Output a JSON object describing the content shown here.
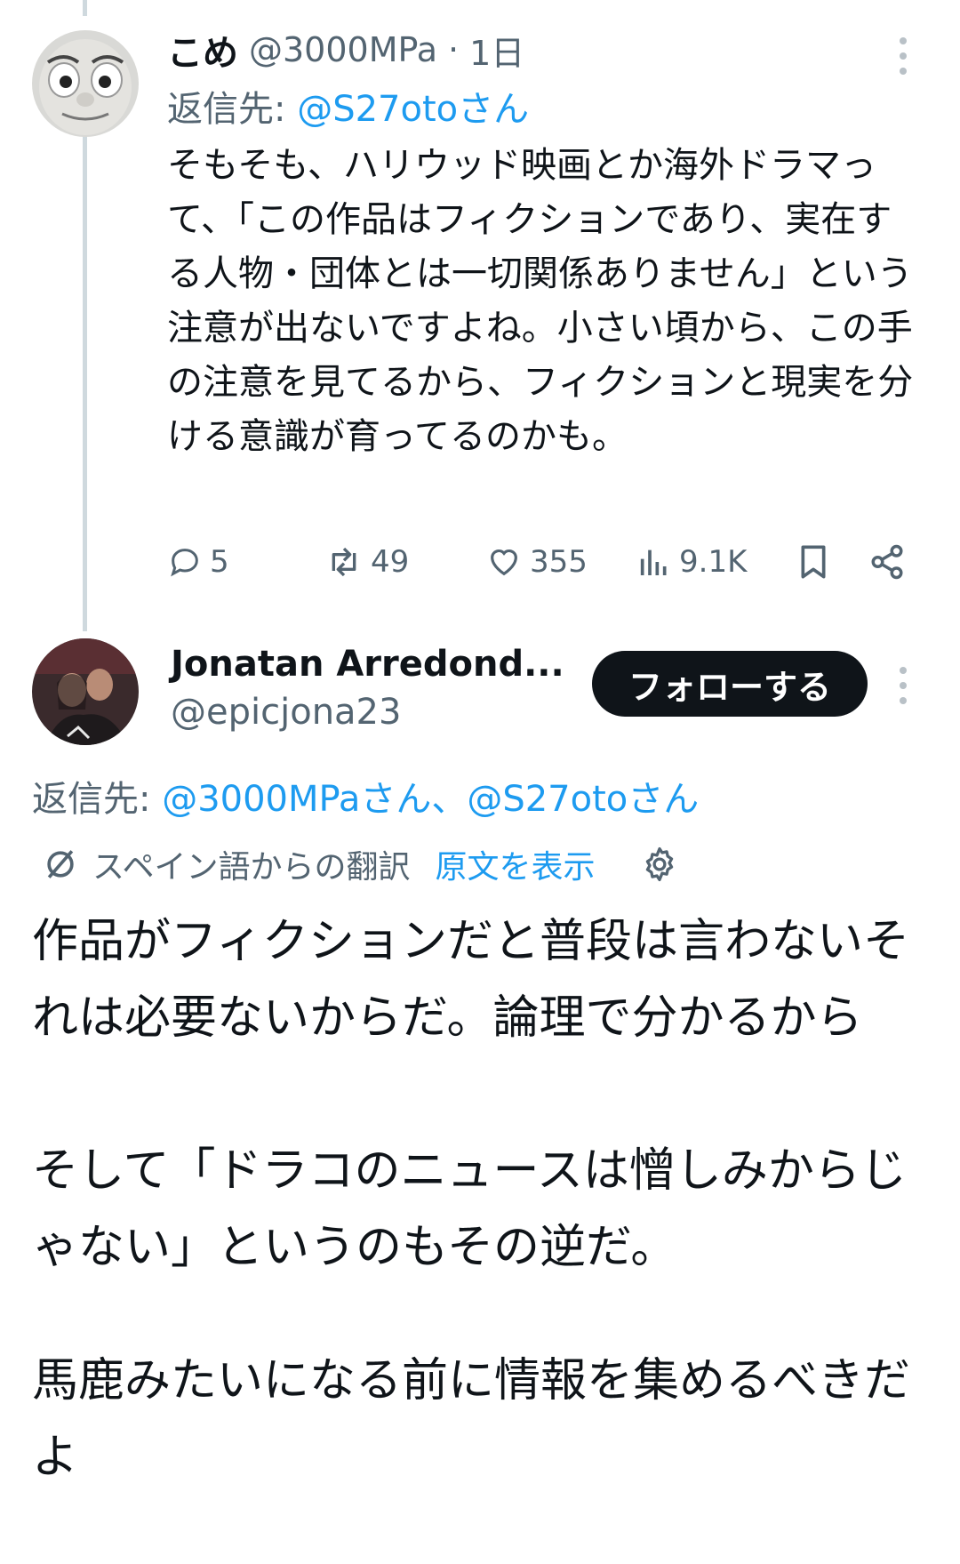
{
  "reply1": {
    "display_name": "こめ",
    "handle": "@3000MPa",
    "separator": "·",
    "time": "1日",
    "reply_to_prefix": "返信先:",
    "reply_to_users": "@S27otoさん",
    "text": "そもそも、ハリウッド映画とか海外ドラマって、「この作品はフィクションであり、実在する人物・団体とは一切関係ありません」という注意が出ないですよね。小さい頃から、この手の注意を見てるから、フィクションと現実を分ける意識が育ってるのかも。",
    "actions": {
      "replies": "5",
      "reposts": "49",
      "likes": "355",
      "views": "9.1K"
    },
    "icons": [
      "reply-icon",
      "repost-icon",
      "like-icon",
      "views-icon",
      "bookmark-icon",
      "share-icon",
      "more-icon"
    ]
  },
  "reply2": {
    "display_name": "Jonatan Arredond...",
    "handle": "@epicjona23",
    "follow_label": "フォローする",
    "reply_to_prefix": "返信先:",
    "reply_to_users": "@3000MPaさん、@S27otoさん",
    "translation_label": "スペイン語からの翻訳",
    "show_original": "原文を表示",
    "paragraphs": [
      "作品がフィクションだと普段は言わないそれは必要ないからだ。論理で分かるから",
      "そして「ドラコのニュースは憎しみからじゃない」というのもその逆だ。",
      "馬鹿みたいになる前に情報を集めるべきだよ"
    ]
  },
  "colors": {
    "link": "#1d9bf0",
    "muted": "#536471",
    "text": "#0f1419",
    "follow_button_bg": "#0f1419"
  }
}
